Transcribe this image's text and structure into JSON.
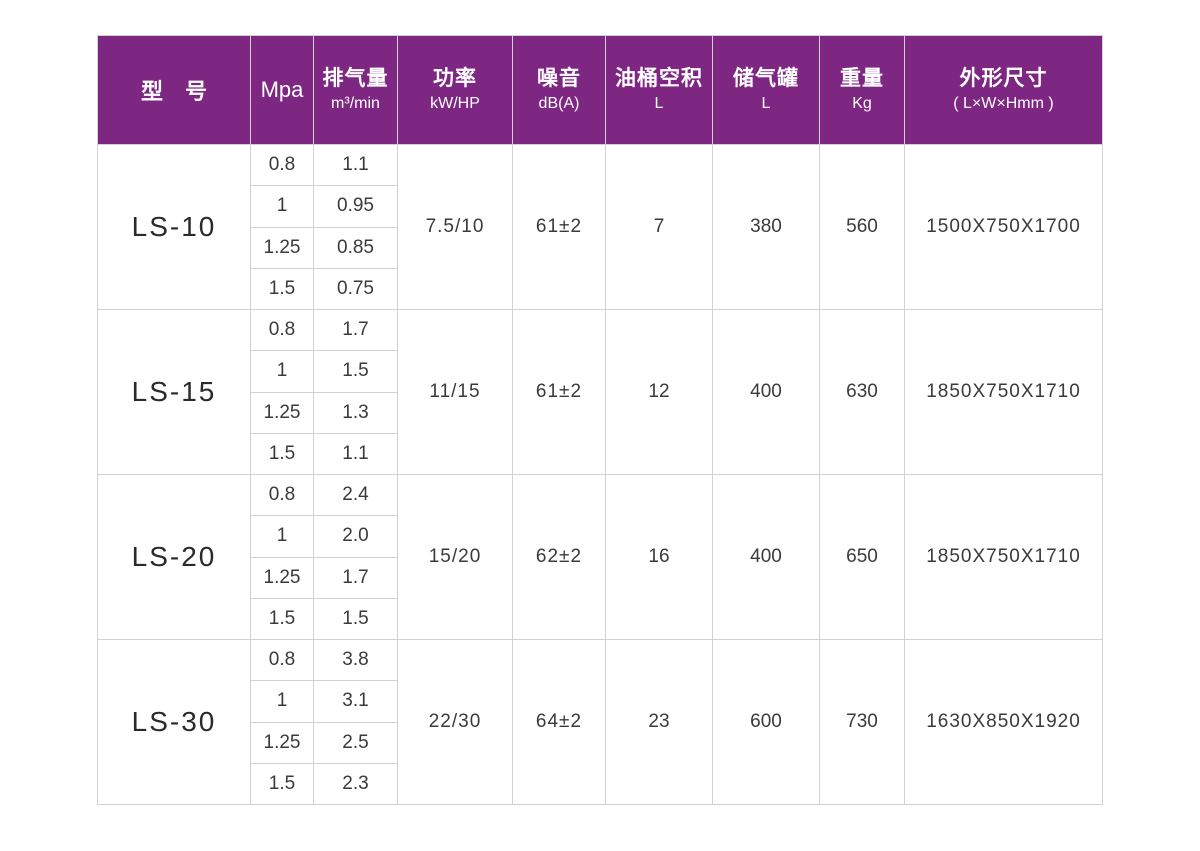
{
  "header": {
    "model": "型　号",
    "pressure": "Mpa",
    "flow": "排气量",
    "flow_unit": "m³/min",
    "power": "功率",
    "power_unit": "kW/HP",
    "noise": "噪音",
    "noise_unit": "dB(A)",
    "oil": "油桶空积",
    "oil_unit": "L",
    "tank": "储气罐",
    "tank_unit": "L",
    "weight": "重量",
    "weight_unit": "Kg",
    "dims": "外形尺寸",
    "dims_unit": "( L×W×Hmm )"
  },
  "rows": [
    {
      "model": "LS-10",
      "sub": [
        {
          "pressure": "0.8",
          "flow": "1.1"
        },
        {
          "pressure": "1",
          "flow": "0.95"
        },
        {
          "pressure": "1.25",
          "flow": "0.85"
        },
        {
          "pressure": "1.5",
          "flow": "0.75"
        }
      ],
      "power": "7.5/10",
      "noise": "61±2",
      "oil": "7",
      "tank": "380",
      "weight": "560",
      "dims": "1500X750X1700"
    },
    {
      "model": "LS-15",
      "sub": [
        {
          "pressure": "0.8",
          "flow": "1.7"
        },
        {
          "pressure": "1",
          "flow": "1.5"
        },
        {
          "pressure": "1.25",
          "flow": "1.3"
        },
        {
          "pressure": "1.5",
          "flow": "1.1"
        }
      ],
      "power": "11/15",
      "noise": "61±2",
      "oil": "12",
      "tank": "400",
      "weight": "630",
      "dims": "1850X750X1710"
    },
    {
      "model": "LS-20",
      "sub": [
        {
          "pressure": "0.8",
          "flow": "2.4"
        },
        {
          "pressure": "1",
          "flow": "2.0"
        },
        {
          "pressure": "1.25",
          "flow": "1.7"
        },
        {
          "pressure": "1.5",
          "flow": "1.5"
        }
      ],
      "power": "15/20",
      "noise": "62±2",
      "oil": "16",
      "tank": "400",
      "weight": "650",
      "dims": "1850X750X1710"
    },
    {
      "model": "LS-30",
      "sub": [
        {
          "pressure": "0.8",
          "flow": "3.8"
        },
        {
          "pressure": "1",
          "flow": "3.1"
        },
        {
          "pressure": "1.25",
          "flow": "2.5"
        },
        {
          "pressure": "1.5",
          "flow": "2.3"
        }
      ],
      "power": "22/30",
      "noise": "64±2",
      "oil": "23",
      "tank": "600",
      "weight": "730",
      "dims": "1630X850X1920"
    }
  ],
  "colors": {
    "header_bg": "#7d2783",
    "header_text": "#ffffff",
    "grid": "#d2d2d2"
  }
}
